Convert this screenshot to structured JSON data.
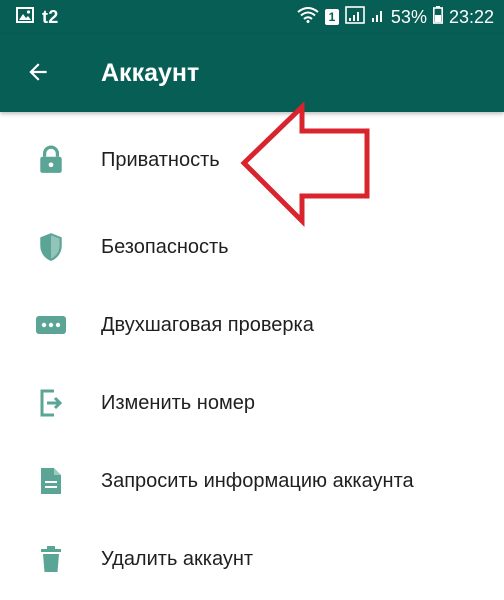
{
  "status_bar": {
    "carrier": "t2",
    "sim_slot": "1",
    "battery_percent": "53%",
    "time": "23:22",
    "icons": [
      "image-icon",
      "wifi-icon",
      "signal-icon",
      "battery-icon"
    ]
  },
  "app_bar": {
    "title": "Аккаунт",
    "background_color": "#075e54",
    "back_icon": "arrow-back-icon"
  },
  "menu": {
    "accent_color": "#5aa595",
    "items": [
      {
        "label": "Приватность",
        "icon": "lock-icon"
      },
      {
        "label": "Безопасность",
        "icon": "shield-icon"
      },
      {
        "label": "Двухшаговая проверка",
        "icon": "password-dots-icon"
      },
      {
        "label": "Изменить номер",
        "icon": "change-number-icon"
      },
      {
        "label": "Запросить информацию аккаунта",
        "icon": "document-icon"
      },
      {
        "label": "Удалить аккаунт",
        "icon": "trash-icon"
      }
    ]
  },
  "annotation": {
    "type": "arrow",
    "color": "#d9232d",
    "points_to": "Приватность"
  }
}
